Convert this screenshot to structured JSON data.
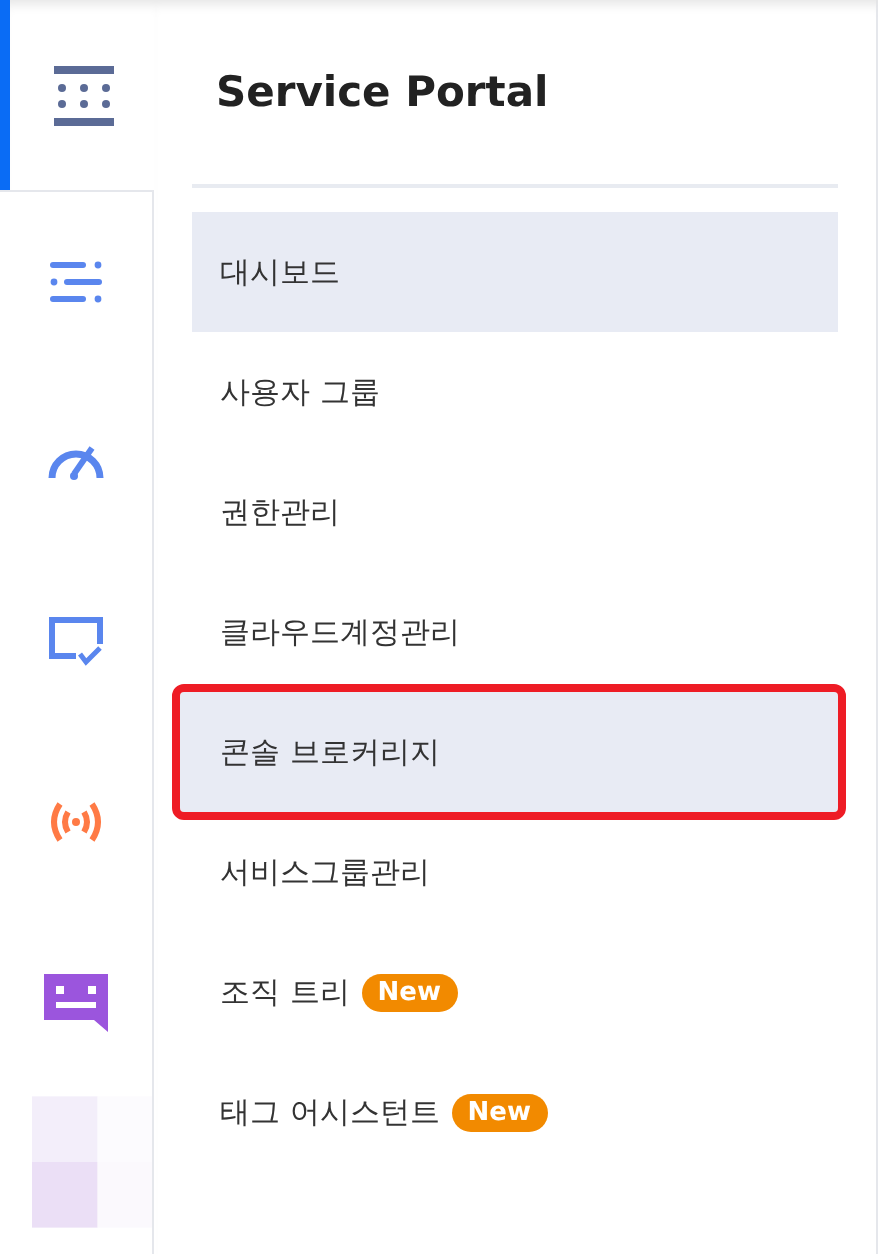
{
  "rail": {
    "top": {
      "kind": "grid",
      "selected": true
    },
    "items": [
      {
        "kind": "list"
      },
      {
        "kind": "gauge"
      },
      {
        "kind": "screen-check"
      },
      {
        "kind": "broadcast"
      },
      {
        "kind": "chat"
      },
      {
        "kind": "faded"
      }
    ]
  },
  "menu": {
    "title": "Service Portal",
    "items": [
      {
        "label": "대시보드",
        "highlighted": true,
        "outlined": false
      },
      {
        "label": "사용자 그룹",
        "highlighted": false,
        "outlined": false
      },
      {
        "label": "권한관리",
        "highlighted": false,
        "outlined": false
      },
      {
        "label": "클라우드계정관리",
        "highlighted": false,
        "outlined": false
      },
      {
        "label": "콘솔 브로커리지",
        "highlighted": true,
        "outlined": true
      },
      {
        "label": "서비스그룹관리",
        "highlighted": false,
        "outlined": false
      },
      {
        "label": "조직 트리",
        "highlighted": false,
        "outlined": false,
        "badge": "New"
      },
      {
        "label": "태그 어시스턴트",
        "highlighted": false,
        "outlined": false,
        "badge": "New"
      }
    ]
  }
}
